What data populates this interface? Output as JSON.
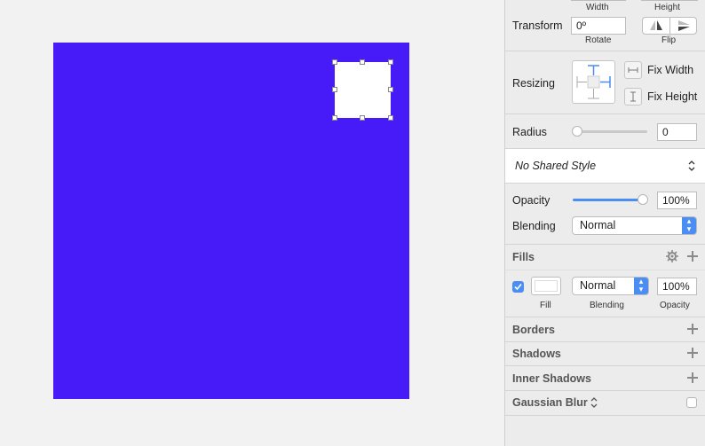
{
  "colors": {
    "artboard": "#471bf7",
    "accent": "#4a8ef4"
  },
  "inspector": {
    "size": {
      "width_label": "Width",
      "height_label": "Height"
    },
    "transform": {
      "label": "Transform",
      "rotate_value": "0º",
      "rotate_label": "Rotate",
      "flip_label": "Flip"
    },
    "resizing": {
      "label": "Resizing",
      "fix_width": "Fix Width",
      "fix_height": "Fix Height"
    },
    "radius": {
      "label": "Radius",
      "value": "0",
      "slider_level": 0
    },
    "shared_style": {
      "value": "No Shared Style"
    },
    "opacity": {
      "label": "Opacity",
      "value": "100%",
      "slider_level": 1.0
    },
    "blending": {
      "label": "Blending",
      "value": "Normal"
    },
    "fills": {
      "title": "Fills",
      "enabled": true,
      "fill_color": "#ffffff",
      "blending_value": "Normal",
      "opacity_value": "100%",
      "fill_caption": "Fill",
      "blending_caption": "Blending",
      "opacity_caption": "Opacity"
    },
    "borders": {
      "title": "Borders"
    },
    "shadows": {
      "title": "Shadows"
    },
    "inner_shadows": {
      "title": "Inner Shadows"
    },
    "gaussian_blur": {
      "title": "Gaussian Blur",
      "enabled": false
    }
  }
}
